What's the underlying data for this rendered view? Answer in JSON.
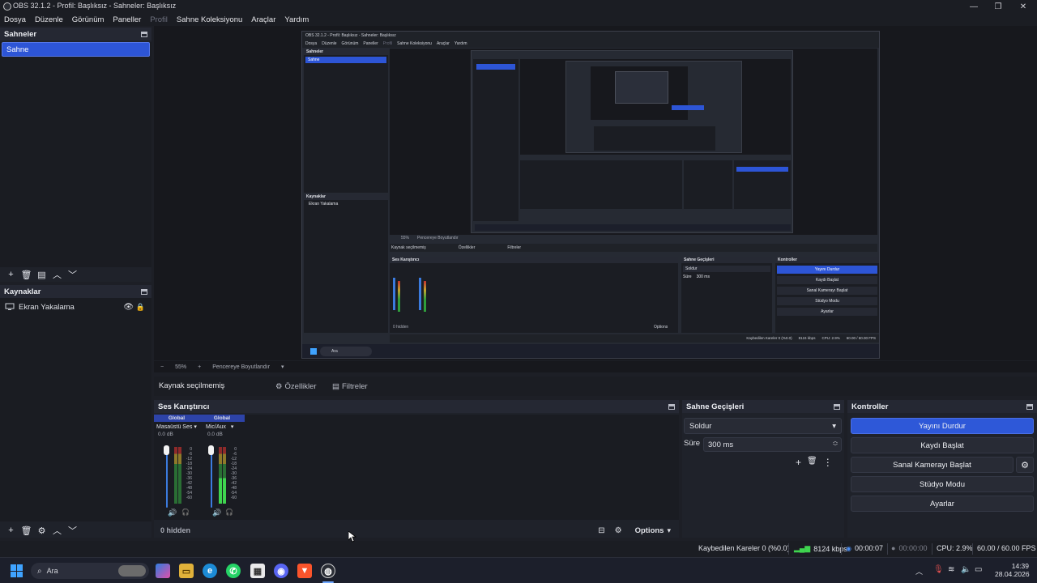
{
  "window": {
    "title": "OBS 32.1.2 - Profil: Başlıksız - Sahneler: Başlıksız"
  },
  "menu": [
    "Dosya",
    "Düzenle",
    "Görünüm",
    "Paneller",
    "Profil",
    "Sahne Koleksiyonu",
    "Araçlar",
    "Yardım"
  ],
  "scenes": {
    "title": "Sahneler",
    "items": [
      "Sahne"
    ]
  },
  "sources": {
    "title": "Kaynaklar",
    "items": [
      {
        "name": "Ekran Yakalama",
        "icon": "monitor-icon"
      }
    ]
  },
  "preview_bar": {
    "zoom": "55%",
    "mode": "Pencereye Boyutlandır"
  },
  "info_bar": {
    "no_source": "Kaynak seçilmemiş",
    "properties": "Özellikler",
    "filters": "Filtreler"
  },
  "mixer": {
    "title": "Ses Karıştırıcı",
    "channels": [
      {
        "tag": "Global",
        "name": "Masaüstü Ses",
        "db": "0.0 dB"
      },
      {
        "tag": "Global",
        "name": "Mic/Aux",
        "db": "0.0 dB"
      }
    ],
    "scale": [
      "0",
      "-6",
      "-12",
      "-18",
      "-24",
      "-30",
      "-36",
      "-42",
      "-48",
      "-54",
      "-60"
    ],
    "hidden": "0 hidden",
    "options": "Options"
  },
  "transitions": {
    "title": "Sahne Geçişleri",
    "selected": "Soldur",
    "duration_label": "Süre",
    "duration": "300 ms"
  },
  "controls": {
    "title": "Kontroller",
    "buttons": [
      "Yayını Durdur",
      "Kaydı Başlat",
      "Sanal Kamerayı Başlat",
      "Stüdyo Modu",
      "Ayarlar"
    ]
  },
  "status": {
    "dropped": "Kaybedilen Kareler 0 (%0.0)",
    "bitrate": "8124 kbps",
    "stream_time": "00:00:07",
    "rec_time": "00:00:00",
    "cpu": "CPU: 2.9%",
    "fps": "60.00 / 60.00 FPS"
  },
  "taskbar": {
    "search": "Ara",
    "time": "14:39",
    "date": "28.04.2026"
  },
  "nested_preview": {
    "title": "OBS 32.1.2 - Profil: Başlıksız - Sahneler: Başlıksız",
    "menu": [
      "Dosya",
      "Düzenle",
      "Görünüm",
      "Paneller",
      "Profil",
      "Sahne Koleksiyonu",
      "Araçlar",
      "Yardım"
    ],
    "scenes_title": "Sahneler",
    "scene": "Sahne",
    "sources_title": "Kaynaklar",
    "source": "Ekran Yakalama",
    "zoom": "55%",
    "fit": "Pencereye Boyutlandır",
    "no_source": "Kaynak seçilmemiş",
    "props": "Özellikler",
    "filters": "Filtreler",
    "mixer_title": "Ses Karıştırıcı",
    "trans_title": "Sahne Geçişleri",
    "fade": "Soldur",
    "duration_label": "Süre",
    "duration": "300 ms",
    "controls_title": "Kontroller",
    "btn_stop": "Yayını Durdur",
    "btn_rec": "Kaydı Başlat",
    "btn_vcam": "Sanal Kamerayı Başlat",
    "btn_studio": "Stüdyo Modu",
    "btn_settings": "Ayarlar",
    "hidden": "0 hidden",
    "options": "Options",
    "status": "Kaybedilen Kareler 0 (%0.0)",
    "kbps": "8124 kbps",
    "cpu": "CPU: 2.9%",
    "fps": "60.00 / 60.00 FPS",
    "search": "Ara"
  }
}
